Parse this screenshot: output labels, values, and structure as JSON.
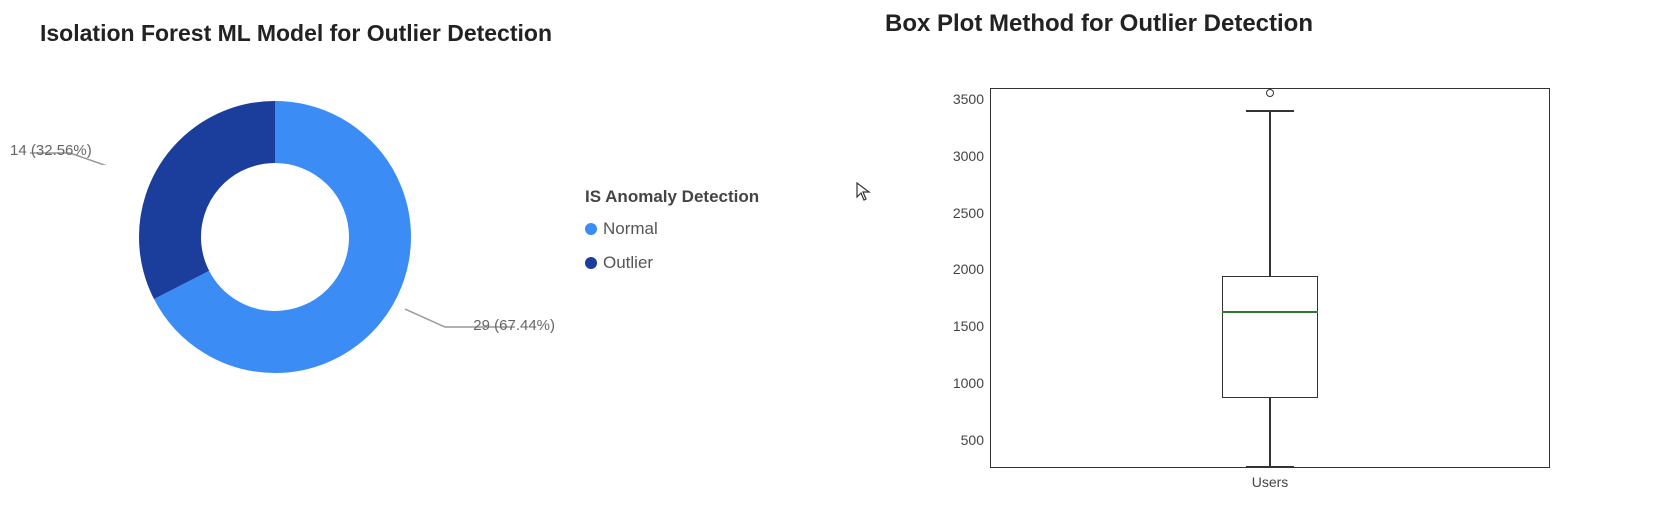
{
  "left": {
    "title": "Isolation Forest ML Model for Outlier Detection",
    "legend_title": "IS Anomaly Detection",
    "legend": [
      {
        "name": "Normal",
        "color": "#3b8df5"
      },
      {
        "name": "Outlier",
        "color": "#1b3e9c"
      }
    ],
    "callouts": {
      "outlier": "14 (32.56%)",
      "normal": "29 (67.44%)"
    }
  },
  "right": {
    "title": "Box Plot Method for Outlier Detection",
    "y_ticks": [
      "3500",
      "3000",
      "2500",
      "2000",
      "1500",
      "1000",
      "500"
    ],
    "x_label": "Users"
  },
  "chart_data": [
    {
      "type": "pie",
      "title": "Isolation Forest ML Model for Outlier Detection",
      "subtitle": "IS Anomaly Detection",
      "hole": 0.55,
      "categories": [
        "Normal",
        "Outlier"
      ],
      "values": [
        29,
        14
      ],
      "percentages": [
        67.44,
        32.56
      ],
      "colors": [
        "#3b8df5",
        "#1b3e9c"
      ],
      "annotations": [
        "29 (67.44%)",
        "14 (32.56%)"
      ]
    },
    {
      "type": "boxplot",
      "title": "Box Plot Method for Outlier Detection",
      "xlabel": "Users",
      "ylabel": "",
      "ylim": [
        250,
        3600
      ],
      "y_ticks": [
        500,
        1000,
        1500,
        2000,
        2500,
        3000,
        3500
      ],
      "series": [
        {
          "name": "Users",
          "min_whisker": 260,
          "q1": 870,
          "median": 1630,
          "q3": 1940,
          "max_whisker": 3410,
          "outliers": [
            3560
          ]
        }
      ]
    }
  ]
}
